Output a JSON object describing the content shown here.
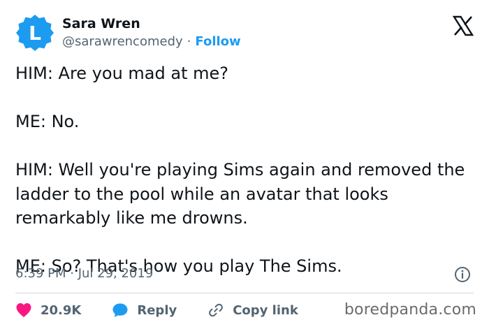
{
  "user": {
    "avatar_letter": "L",
    "avatar_color": "#1d9bf0",
    "name": "Sara Wren",
    "handle": "@sarawrencomedy",
    "separator": "·",
    "follow_label": "Follow"
  },
  "brand": {
    "logo_icon": "x-logo-icon"
  },
  "tweet": {
    "paragraphs": [
      "HIM: Are you mad at me?",
      "ME: No.",
      "HIM: Well you're playing Sims again and removed the ladder to the pool while an avatar that looks remarkably like me drowns.",
      "ME: So? That's how you play The Sims."
    ],
    "timestamp": "6:39 PM · Jul 29, 2019"
  },
  "actions": {
    "like_count": "20.9K",
    "reply_label": "Reply",
    "copy_link_label": "Copy link",
    "like_color": "#f91880",
    "reply_color": "#1d9bf0"
  },
  "watermark": "boredpanda.com"
}
